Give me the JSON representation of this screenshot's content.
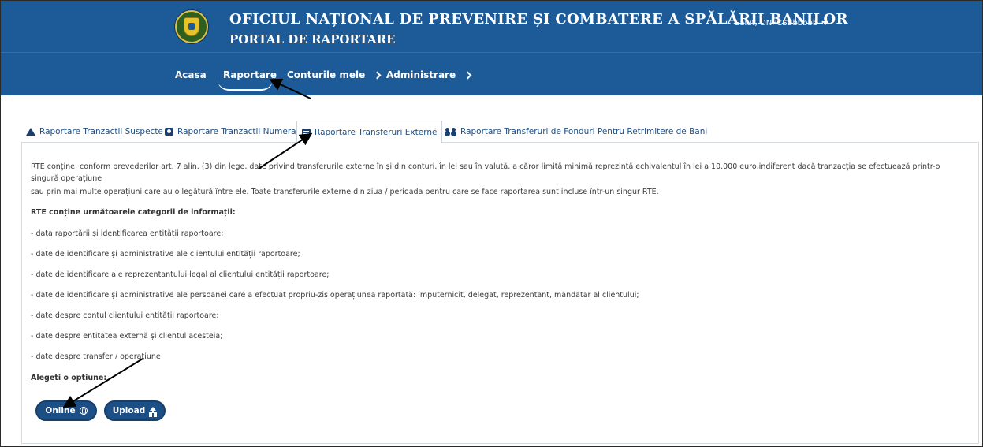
{
  "header": {
    "title_line1": "OFICIUL NAȚIONAL DE PREVENIRE ȘI COMBATERE A SPĂLĂRII BANILOR",
    "title_line2": "PORTAL DE RAPORTARE",
    "user_greeting": "Salut, ONPCSBbbbbb"
  },
  "nav": {
    "items": [
      {
        "label": "Acasa"
      },
      {
        "label": "Raportare"
      },
      {
        "label": "Conturile mele"
      },
      {
        "label": "Administrare"
      }
    ],
    "active": "Raportare"
  },
  "tabs": [
    {
      "label": "Raportare Tranzactii Suspecte",
      "icon": "warning-icon"
    },
    {
      "label": "Raportare Tranzactii Numerar",
      "icon": "money-icon"
    },
    {
      "label": "Raportare Transferuri Externe",
      "icon": "card-icon"
    },
    {
      "label": "Raportare Transferuri de Fonduri Pentru Retrimitere de Bani",
      "icon": "people-transfer-icon"
    }
  ],
  "active_tab": "Raportare Transferuri Externe",
  "content": {
    "intro_line1": "RTE conține, conform prevederilor art. 7 alin. (3) din lege, date privind transferurile externe în și din conturi, în lei sau în valută, a căror limită minimă reprezintă echivalentul în lei a 10.000 euro,indiferent dacă tranzacția se efectuează printr-o",
    "intro_line2": "singură operațiune",
    "intro_line3": "sau prin mai multe operațiuni care au o legătură între ele. Toate transferurile externe din ziua / perioada pentru care se face raportarea sunt incluse într-un singur RTE.",
    "categories_heading": "RTE conține următoarele categorii de informații:",
    "categories": [
      "- data raportării și identificarea entității raportoare;",
      "- date de identificare și administrative ale clientului entității raportoare;",
      "- date de identificare ale reprezentantului legal al clientului entității raportoare;",
      "- date de identificare și administrative ale persoanei care a efectuat propriu-zis operațiunea raportată: împuternicit, delegat, reprezentant, mandatar al clientului;",
      "- date despre contul clientului entității raportoare;",
      "- date despre entitatea externă și clientul acesteia;",
      "- date despre transfer / operațiune"
    ],
    "choose_label": "Alegeti o optiune:"
  },
  "buttons": {
    "online_label": "Online",
    "upload_label": "Upload"
  },
  "colors": {
    "header_bg": "#1c5a98",
    "button_bg": "#1c4f86",
    "tab_text": "#1c4f86"
  }
}
